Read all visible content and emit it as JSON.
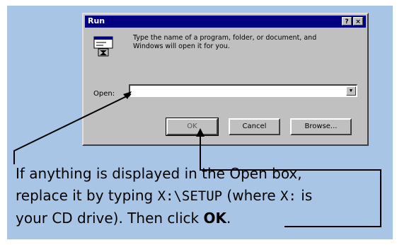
{
  "dialog": {
    "title": "Run",
    "help_glyph": "?",
    "close_glyph": "×",
    "prompt": "Type the name of a program, folder, or document, and Windows will open it for you.",
    "open_label": "Open:",
    "open_value": "",
    "dropdown_glyph": "▼",
    "buttons": {
      "ok": "OK",
      "cancel": "Cancel",
      "browse": "Browse..."
    }
  },
  "caption": {
    "line1": "If anything is displayed in the Open box,",
    "line2_a": "replace it by typing ",
    "line2_cmd": "X:\\SETUP",
    "line2_b": " (where ",
    "line2_drive": "X:",
    "line2_c": " is",
    "line3_a": "your CD drive). Then click ",
    "line3_ok": "OK",
    "line3_b": "."
  },
  "colors": {
    "panel_bg": "#a9c5e6",
    "dialog_face": "#c0c0c0",
    "titlebar": "#000080",
    "callout_line": "#000000"
  },
  "icons": [
    "run-program-icon",
    "help-icon",
    "close-icon",
    "dropdown-arrow-icon"
  ]
}
